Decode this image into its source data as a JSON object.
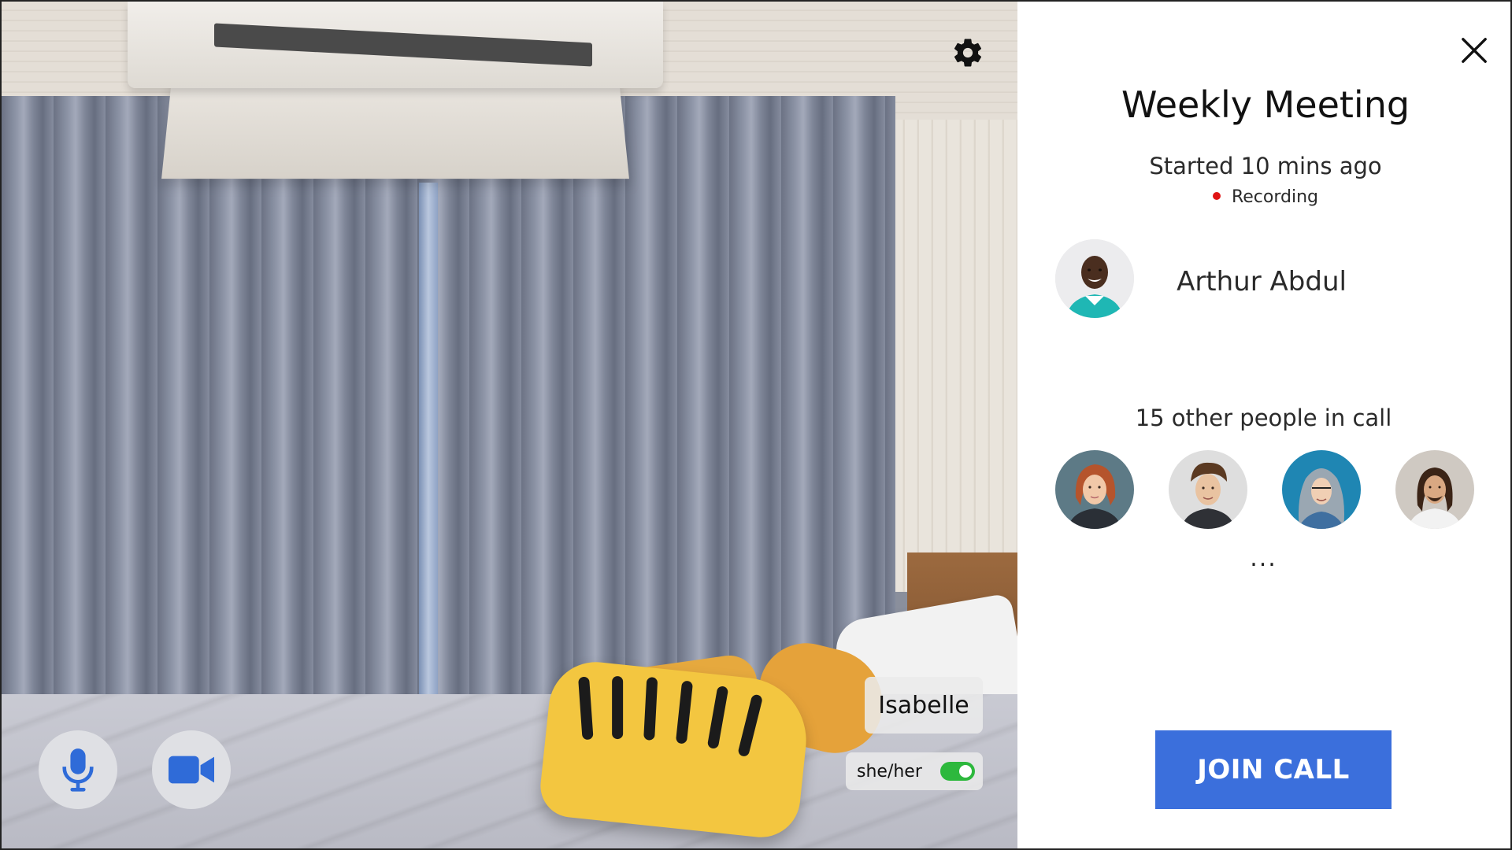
{
  "video": {
    "participant_name": "Isabelle",
    "pronouns": "she/her",
    "pronouns_toggle_on": true,
    "settings_icon": "gear-icon",
    "mic_icon": "microphone-icon",
    "camera_icon": "video-camera-icon"
  },
  "panel": {
    "close_icon": "close-icon",
    "title": "Weekly Meeting",
    "started": "Started 10 mins ago",
    "recording_label": "Recording",
    "host": {
      "name": "Arthur Abdul"
    },
    "others_label": "15 other people in call",
    "more_label": "...",
    "join_label": "JOIN CALL"
  },
  "colors": {
    "accent": "#3b6fdc",
    "icon_blue": "#2f6bd8",
    "toggle_on": "#2db83d",
    "recording_dot": "#e01414"
  }
}
